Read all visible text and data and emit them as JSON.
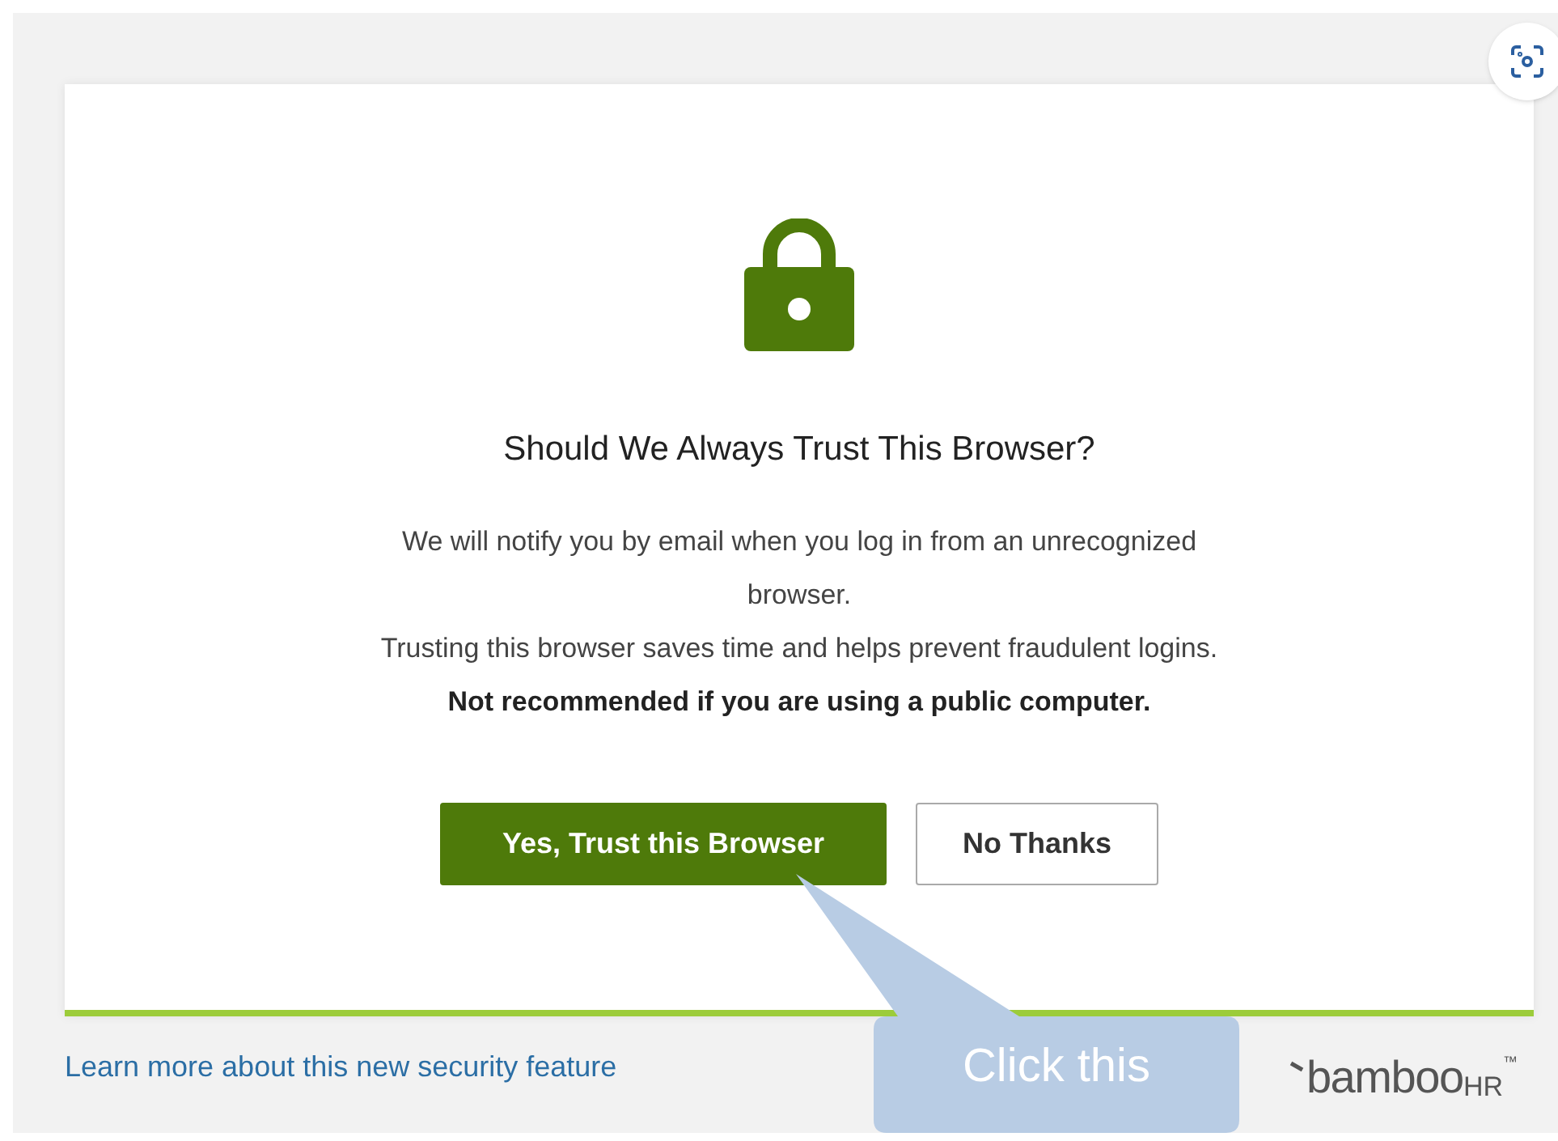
{
  "dialog": {
    "title": "Should We Always Trust This Browser?",
    "paragraphs": [
      {
        "text": "We will notify you by email when you log in from an unrecognized browser.",
        "bold": false
      },
      {
        "text": "Trusting this browser saves time and helps prevent fraudulent logins.",
        "bold": false
      },
      {
        "text": "Not recommended if you are using a public computer.",
        "bold": true
      }
    ],
    "buttons": [
      {
        "label": "Yes, Trust this Browser",
        "kind": "primary"
      },
      {
        "label": "No Thanks",
        "kind": "secondary"
      }
    ]
  },
  "footer": {
    "link": "Learn more about this new security feature",
    "logo": {
      "text": "bamboo",
      "suffix": "HR",
      "mark": "™"
    }
  },
  "callout": {
    "text": "Click this"
  }
}
